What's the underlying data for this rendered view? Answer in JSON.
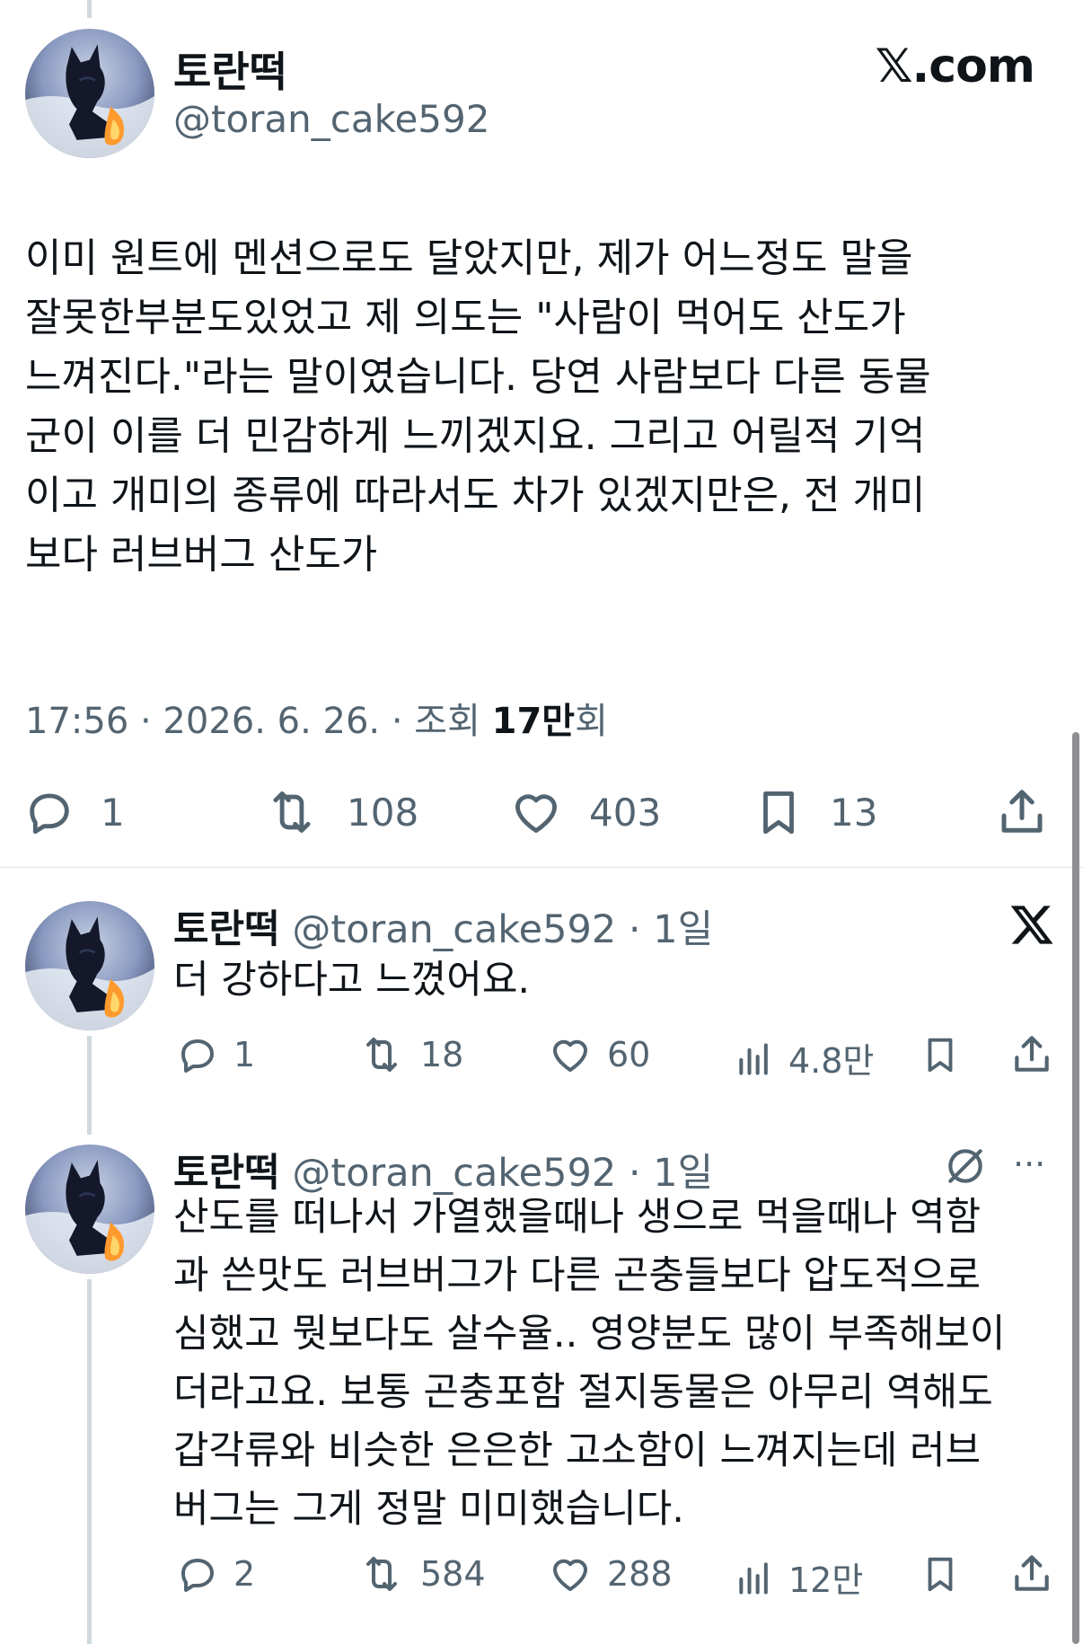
{
  "main_tweet": {
    "author_name": "토란떡",
    "author_handle": "@toran_cake592",
    "source_label": "𝕏.com",
    "text": "이미 원트에 멘션으로도 달았지만, 제가 어느정도 말을\n잘못한부분도있었고 제 의도는 \"사람이 먹어도 산도가\n느껴진다.\"라는 말이였습니다. 당연 사람보다 다른 동물\n군이 이를 더 민감하게 느끼겠지요. 그리고 어릴적 기억\n이고 개미의 종류에 따라서도 차가 있겠지만은, 전 개미\n보다 러브버그 산도가",
    "time": "17:56 · 2026. 6. 26. · 조회 ",
    "views": "17만",
    "views_suffix": "회",
    "replies": "1",
    "retweets": "108",
    "likes": "403",
    "bookmarks": "13"
  },
  "replies": [
    {
      "author_name": "토란떡",
      "author_handle": "@toran_cake592",
      "age": "· 1일",
      "corner_icon": "x-logo-icon",
      "text": "더 강하다고 느꼈어요.",
      "replies": "1",
      "retweets": "18",
      "likes": "60",
      "views": "4.8만"
    },
    {
      "author_name": "토란떡",
      "author_handle": "@toran_cake592",
      "age": "· 1일",
      "corner_icon": "grok-icon",
      "more_label": "···",
      "text": "산도를 떠나서 가열했을때나 생으로 먹을때나 역함\n과 쓴맛도 러브버그가 다른 곤충들보다 압도적으로\n심했고 뭣보다도 살수율.. 영양분도 많이 부족해보이\n더라고요. 보통 곤충포함 절지동물은 아무리 역해도\n갑각류와 비슷한 은은한 고소함이 느껴지는데 러브\n버그는 그게 정말 미미했습니다.",
      "replies": "2",
      "retweets": "584",
      "likes": "288",
      "views": "12만"
    }
  ],
  "colors": {
    "text": "#0f1419",
    "secondary": "#536471",
    "thread_line": "#cfd9de"
  }
}
